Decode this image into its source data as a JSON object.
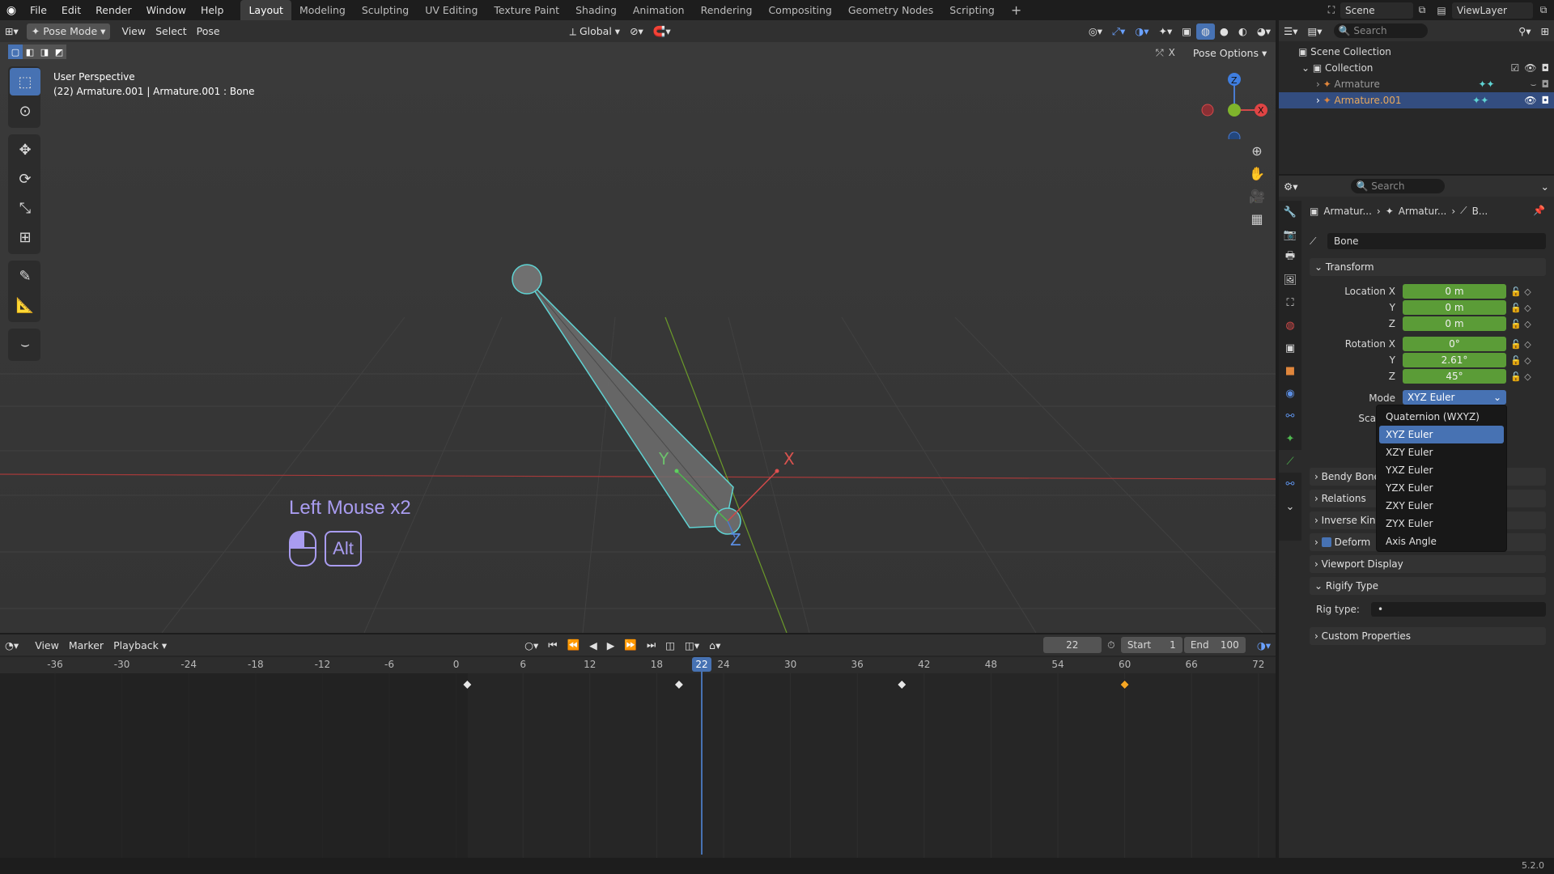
{
  "menu": {
    "items": [
      "File",
      "Edit",
      "Render",
      "Window",
      "Help"
    ]
  },
  "workspaces": [
    "Layout",
    "Modeling",
    "Sculpting",
    "UV Editing",
    "Texture Paint",
    "Shading",
    "Animation",
    "Rendering",
    "Compositing",
    "Geometry Nodes",
    "Scripting"
  ],
  "scene": {
    "label": "Scene",
    "viewlayer": "ViewLayer"
  },
  "viewport": {
    "mode": "Pose Mode",
    "menus": [
      "View",
      "Select",
      "Pose"
    ],
    "transform": "Global",
    "pose_options": "Pose Options",
    "x_label": "X",
    "overlay_title": "User Perspective",
    "overlay_sub": "(22) Armature.001 | Armature.001 : Bone",
    "axis_x": "X",
    "axis_y": "Y",
    "axis_z": "Z",
    "keyhint": "Left Mouse x2",
    "alt_label": "Alt"
  },
  "timeline": {
    "menus": [
      "View",
      "Marker",
      "Playback"
    ],
    "current_frame": "22",
    "start_label": "Start",
    "start": "1",
    "end_label": "End",
    "end": "100",
    "ticks": [
      "-36",
      "-30",
      "-24",
      "-18",
      "-12",
      "-6",
      "0",
      "6",
      "12",
      "18",
      "24",
      "30",
      "36",
      "42",
      "48",
      "54",
      "60",
      "66",
      "72"
    ]
  },
  "outliner": {
    "search_placeholder": "Search",
    "scene_collection": "Scene Collection",
    "collection": "Collection",
    "items": [
      "Armature",
      "Armature.001"
    ]
  },
  "properties": {
    "search_placeholder": "Search",
    "breadcrumb": [
      "Armatur...",
      "Armatur...",
      "B..."
    ],
    "bone_name": "Bone",
    "transform": "Transform",
    "location_x_label": "Location X",
    "y_label": "Y",
    "z_label": "Z",
    "loc": [
      "0 m",
      "0 m",
      "0 m"
    ],
    "rotation_x_label": "Rotation X",
    "rot": [
      "0°",
      "2.61°",
      "45°"
    ],
    "mode_label": "Mode",
    "mode_value": "XYZ Euler",
    "scale_label": "Sca",
    "panels": [
      "Bendy Bone",
      "Relations",
      "Inverse Kin",
      "Deform",
      "Viewport Display",
      "Rigify Type",
      "Custom Properties"
    ],
    "rig_type_label": "Rig type:",
    "rig_type_value": "•"
  },
  "dropdown": {
    "options": [
      "Quaternion (WXYZ)",
      "XYZ Euler",
      "XZY Euler",
      "YXZ Euler",
      "YZX Euler",
      "ZXY Euler",
      "ZYX Euler",
      "Axis Angle"
    ],
    "selected": "XYZ Euler"
  },
  "status": {
    "version": "5.2.0"
  },
  "colors": {
    "accent": "#4772b3",
    "field_green": "#5b9c37",
    "key_selected": "#f5a623",
    "hint_purple": "#a99cf0"
  }
}
